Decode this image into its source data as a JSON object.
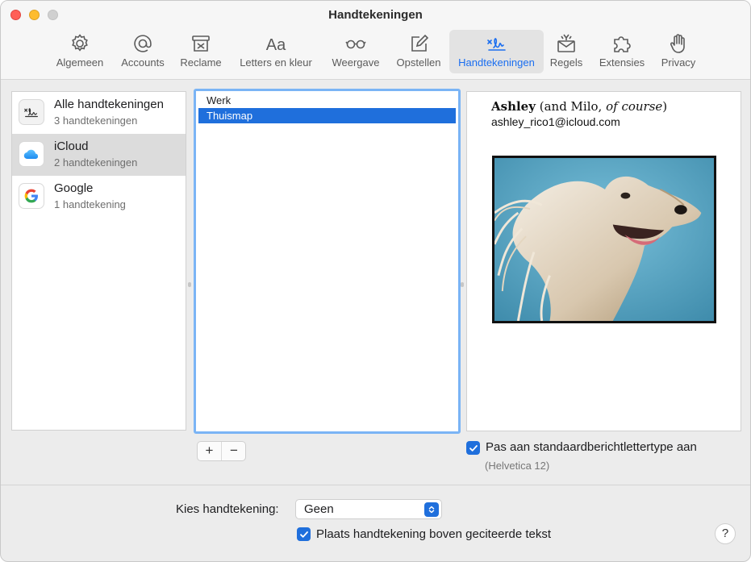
{
  "window": {
    "title": "Handtekeningen"
  },
  "toolbar": {
    "items": [
      {
        "label": "Algemeen",
        "icon": "gear-icon"
      },
      {
        "label": "Accounts",
        "icon": "at-icon"
      },
      {
        "label": "Reclame",
        "icon": "junk-mail-icon"
      },
      {
        "label": "Letters en kleur",
        "icon": "fonts-icon"
      },
      {
        "label": "Weergave",
        "icon": "glasses-icon"
      },
      {
        "label": "Opstellen",
        "icon": "compose-icon"
      },
      {
        "label": "Handtekeningen",
        "icon": "signature-icon",
        "active": true
      },
      {
        "label": "Regels",
        "icon": "rules-envelope-icon"
      },
      {
        "label": "Extensies",
        "icon": "puzzle-icon"
      },
      {
        "label": "Privacy",
        "icon": "hand-icon"
      }
    ]
  },
  "accounts": [
    {
      "name": "Alle handtekeningen",
      "count": "3 handtekeningen",
      "icon": "signature-icon"
    },
    {
      "name": "iCloud",
      "count": "2 handtekeningen",
      "icon": "icloud-icon",
      "selected": true
    },
    {
      "name": "Google",
      "count": "1 handtekening",
      "icon": "google-icon"
    }
  ],
  "signatures": {
    "items": [
      {
        "label": "Werk"
      },
      {
        "label": "Thuismap",
        "selected": true
      }
    ],
    "add_label": "+",
    "remove_label": "−"
  },
  "preview": {
    "name": "Ashley",
    "note_prefix": "(and Milo, ",
    "note_italic": "of course",
    "note_suffix": ")",
    "email": "ashley_rico1@icloud.com",
    "photo": "afghan-hound-photo"
  },
  "font_match": {
    "checked": true,
    "label": "Pas aan standaardberichtlettertype aan",
    "font": "(Helvetica 12)"
  },
  "bottom": {
    "choose_label": "Kies handtekening:",
    "choose_value": "Geen",
    "place_above": {
      "checked": true,
      "label": "Plaats handtekening boven geciteerde tekst"
    },
    "help_label": "?"
  },
  "colors": {
    "accent": "#1f6fdc",
    "selection_bg": "#dcdcdc",
    "focus_ring": "#7ab4f5",
    "close": "#ff5f57",
    "minimize": "#febc2e"
  }
}
